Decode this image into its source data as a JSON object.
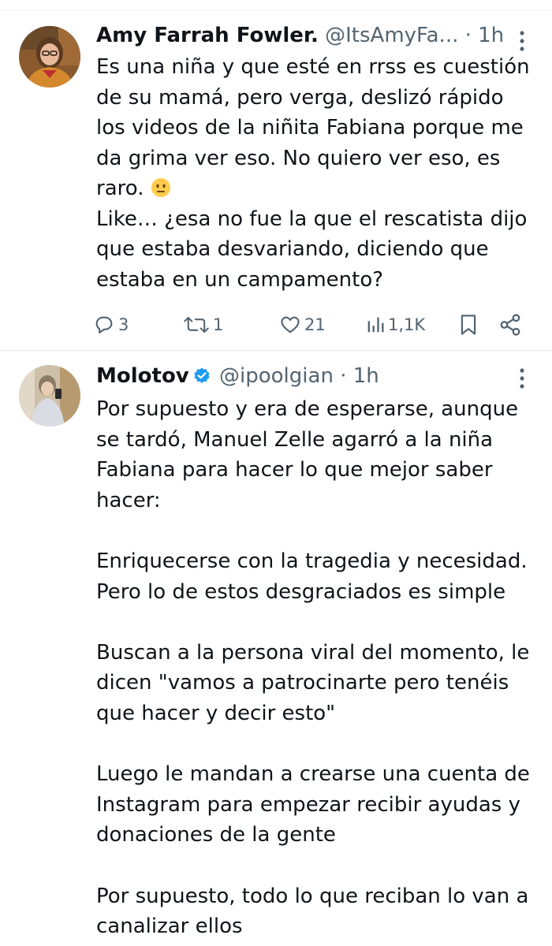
{
  "tweets": [
    {
      "display_name": "Amy Farrah Fowler.",
      "handle": "@ItsAmyFa...",
      "separator": "·",
      "time": "1h",
      "verified": false,
      "body_line1": "Es una niña y que esté en rrss es cuestión",
      "body_line2": "de su mamá, pero verga, deslizó rápido",
      "body_line3": "los videos de la niñita Fabiana porque me",
      "body_line4": "da grima ver eso. No quiero ver eso, es",
      "body_line5": "raro. ",
      "body_line6": "Like… ¿esa no fue la que el rescatista dijo",
      "body_line7": "que estaba desvariando, diciendo que",
      "body_line8": "estaba en un campamento?",
      "replies": "3",
      "reposts": "1",
      "likes": "21",
      "views": "1,1K",
      "avatar_color": "#c47a2c"
    },
    {
      "display_name": "Molotov",
      "handle": "@ipoolgian",
      "separator": "·",
      "time": "1h",
      "verified": true,
      "verified_color": "#1d9bf0",
      "body_p1": "Por supuesto y era de esperarse, aunque\nse tardó, Manuel Zelle agarró a la niña\nFabiana para hacer lo que mejor saber\nhacer:",
      "body_p2": "Enriquecerse con la tragedia y necesidad.\nPero lo de estos desgraciados es simple",
      "body_p3": "Buscan a la persona viral del momento, le\ndicen \"vamos a patrocinarte pero tenéis\nque hacer y decir esto\"",
      "body_p4": "Luego le mandan a crearse una cuenta de\nInstagram para empezar recibir ayudas y\ndonaciones de la gente",
      "body_p5": "Por supuesto, todo lo que reciban lo van a\ncanalizar ellos"
    }
  ],
  "colors": {
    "text": "#0f1419",
    "secondary": "#536471",
    "divider": "#e6ecf0",
    "accent": "#1d9bf0"
  },
  "icons": {
    "reply": "reply-icon",
    "repost": "repost-icon",
    "like": "heart-icon",
    "views": "views-icon",
    "bookmark": "bookmark-icon",
    "share": "share-icon",
    "more": "more-vertical-icon",
    "verified": "verified-badge-icon",
    "emoji": "neutral-face-emoji"
  }
}
